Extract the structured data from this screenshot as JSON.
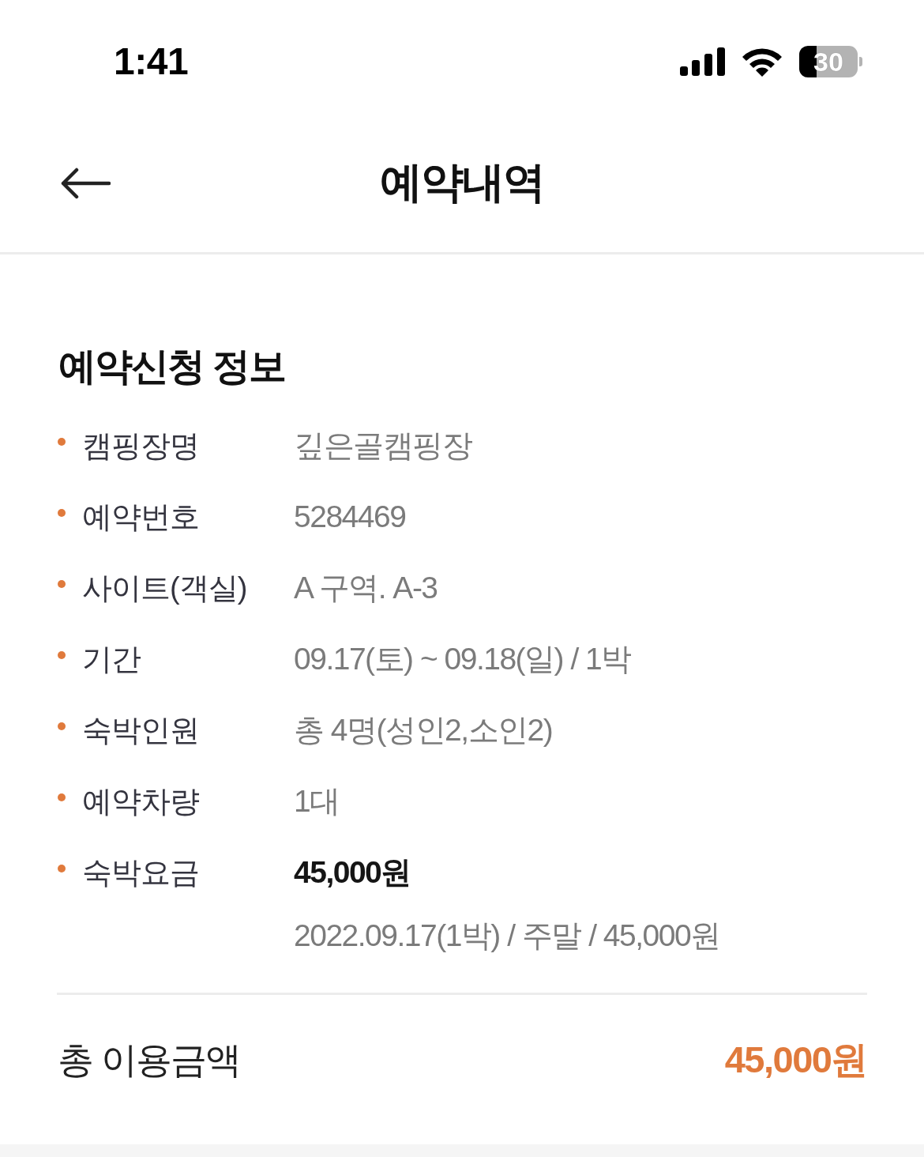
{
  "status_bar": {
    "time": "1:41",
    "battery": "30"
  },
  "header": {
    "title": "예약내역"
  },
  "section": {
    "title": "예약신청 정보",
    "details": [
      {
        "kind": "text",
        "label": "캠핑장명",
        "value": "깊은골캠핑장"
      },
      {
        "kind": "text",
        "label": "예약번호",
        "value": "5284469"
      },
      {
        "kind": "text",
        "label": "사이트(객실)",
        "value": "A 구역. A-3"
      },
      {
        "kind": "text",
        "label": "기간",
        "value": "09.17(토) ~ 09.18(일) / 1박"
      },
      {
        "kind": "text",
        "label": "숙박인원",
        "value": "총 4명(성인2,소인2)"
      },
      {
        "kind": "text",
        "label": "예약차량",
        "value": "1대"
      },
      {
        "kind": "price",
        "label": "숙박요금",
        "value": "45,000원",
        "note": "2022.09.17(1박) / 주말 / 45,000원"
      }
    ]
  },
  "total": {
    "label": "총 이용금액",
    "amount": "45,000원"
  }
}
